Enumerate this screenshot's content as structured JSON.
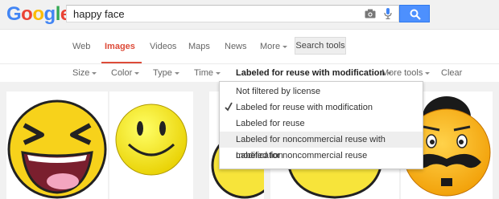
{
  "logo": {
    "letters": [
      "G",
      "o",
      "o",
      "g",
      "l",
      "e"
    ],
    "colors": [
      "#4285f4",
      "#ea4335",
      "#fbbc05",
      "#4285f4",
      "#34a853",
      "#ea4335"
    ]
  },
  "search": {
    "value": "happy face"
  },
  "tabs": [
    {
      "label": "Web"
    },
    {
      "label": "Images"
    },
    {
      "label": "Videos"
    },
    {
      "label": "Maps"
    },
    {
      "label": "News"
    },
    {
      "label": "More"
    }
  ],
  "tools_button": {
    "label": "Search tools"
  },
  "filters": [
    {
      "label": "Size"
    },
    {
      "label": "Color"
    },
    {
      "label": "Type"
    },
    {
      "label": "Time"
    },
    {
      "label": "Labeled for reuse with modification"
    },
    {
      "label": "More tools"
    },
    {
      "label": "Clear"
    }
  ],
  "license_menu": {
    "items": [
      {
        "label": "Not filtered by license",
        "checked": false
      },
      {
        "label": "Labeled for reuse with modification",
        "checked": true
      },
      {
        "label": "Labeled for reuse",
        "checked": false
      },
      {
        "label": "Labeled for noncommercial reuse with modification",
        "checked": false,
        "hovered": true
      },
      {
        "label": "Labeled for noncommercial reuse",
        "checked": false
      }
    ]
  },
  "colors": {
    "accent_red": "#dd4b39",
    "search_blue": "#4d90fe"
  },
  "icons": {
    "camera": "camera-icon",
    "mic": "microphone-icon",
    "search": "search-icon",
    "check": "check-icon"
  }
}
